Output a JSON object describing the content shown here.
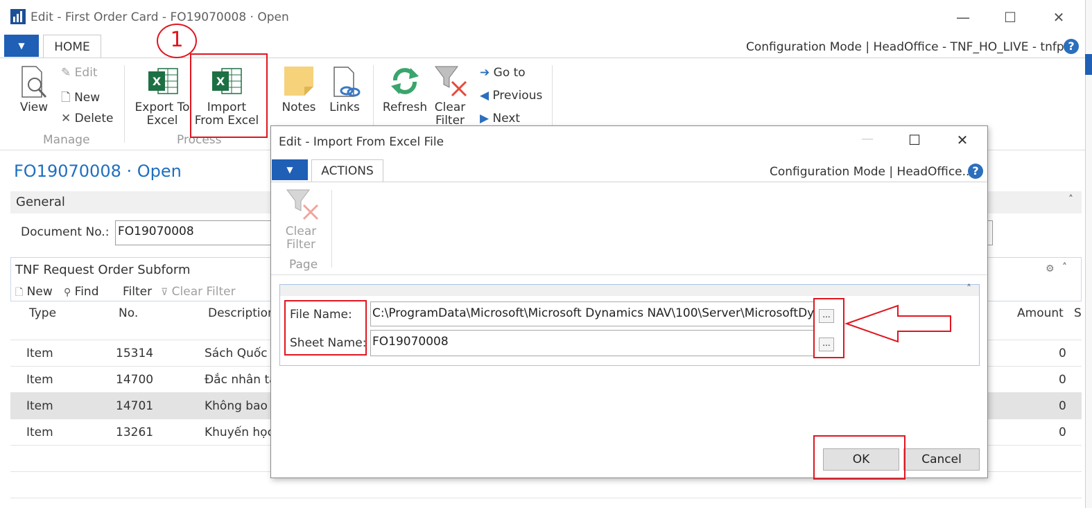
{
  "main_window": {
    "title": "Edit - First Order Card - FO19070008 · Open",
    "home_tab": "HOME",
    "config_text": "Configuration Mode | HeadOffice - TNF_HO_LIVE - tnfp...",
    "help_glyph": "?",
    "ribbon": {
      "manage": {
        "view": "View",
        "edit": "Edit",
        "new": "New",
        "delete": "Delete",
        "group_label": "Manage"
      },
      "process": {
        "export_to_excel": [
          "Export To",
          "Excel"
        ],
        "import_from_excel": [
          "Import",
          "From Excel"
        ],
        "group_label": "Process"
      },
      "notes": "Notes",
      "links": "Links",
      "refresh": "Refresh",
      "clear_filter": [
        "Clear",
        "Filter"
      ],
      "go_to": "Go to",
      "previous": "Previous",
      "next": "Next"
    },
    "page_title": "FO19070008 · Open",
    "general": {
      "section_label": "General",
      "document_no_label": "Document No.:",
      "document_no_value": "FO19070008"
    },
    "subform": {
      "title": "TNF Request Order Subform",
      "actions": {
        "new": "New",
        "find": "Find",
        "filter": "Filter",
        "clear_filter": "Clear Filter"
      },
      "columns": {
        "type": "Type",
        "no": "No.",
        "description": "Description",
        "amount": "Amount",
        "last_col": "S"
      },
      "rows": [
        {
          "type": "Item",
          "no": "15314",
          "description": "Sách Quốc g",
          "amount": "0"
        },
        {
          "type": "Item",
          "no": "14700",
          "description": "Đắc nhân tâm",
          "amount": "0"
        },
        {
          "type": "Item",
          "no": "14701",
          "description": "Không bao g",
          "amount": "0"
        },
        {
          "type": "Item",
          "no": "13261",
          "description": "Khuyến học",
          "amount": "0"
        }
      ]
    }
  },
  "dialog": {
    "title": "Edit - Import From Excel File",
    "actions_tab": "ACTIONS",
    "config_text": "Configuration Mode | HeadOffice...",
    "clear_filter": [
      "Clear",
      "Filter"
    ],
    "group_label": "Page",
    "file_name_label": "File Name:",
    "file_name_value": "C:\\ProgramData\\Microsoft\\Microsoft Dynamics NAV\\100\\Server\\MicrosoftDynamicsNavServer",
    "sheet_name_label": "Sheet Name:",
    "sheet_name_value": "FO19070008",
    "ellipsis": "...",
    "ok": "OK",
    "cancel": "Cancel"
  },
  "annotation": {
    "step_number": "1"
  },
  "colors": {
    "accent_blue": "#1f5fb6",
    "title_blue": "#1f6fc0",
    "annotation_red": "#e0151f",
    "excel_green": "#1d7044"
  }
}
